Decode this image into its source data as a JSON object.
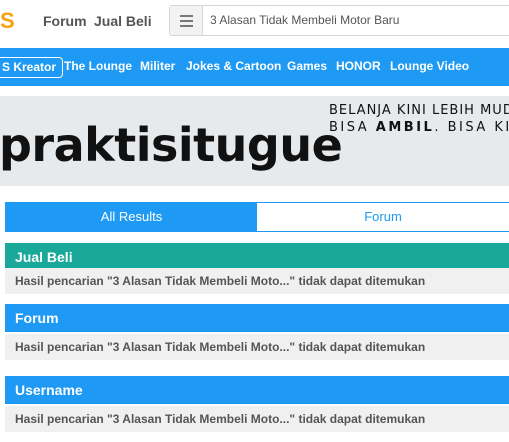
{
  "header": {
    "logo": "S",
    "nav": [
      "Forum",
      "Jual Beli"
    ],
    "search_value": "3 Alasan Tidak Membeli Motor Baru"
  },
  "channels": {
    "kreator": "S Kreator",
    "items": [
      "The Lounge",
      "Militer",
      "Jokes & Cartoon",
      "Games",
      "HONOR",
      "Lounge Video"
    ]
  },
  "banner": {
    "name": "praktisitugue",
    "line1": "BELANJA KINI LEBIH MUDAH",
    "line2_a": "BISA ",
    "line2_b": "AMBIL",
    "line2_c": ". BISA KI"
  },
  "tabs": {
    "all": "All Results",
    "forum": "Forum"
  },
  "results": [
    {
      "title": "Jual Beli",
      "message": "Hasil pencarian \"3 Alasan Tidak Membeli Moto...\" tidak dapat ditemukan"
    },
    {
      "title": "Forum",
      "message": "Hasil pencarian \"3 Alasan Tidak Membeli Moto...\" tidak dapat ditemukan"
    },
    {
      "title": "Username",
      "message": "Hasil pencarian \"3 Alasan Tidak Membeli Moto...\" tidak dapat ditemukan"
    }
  ],
  "colors": {
    "brand_orange": "#f8a10f",
    "nav_blue": "#1e9af5",
    "jualbeli_teal": "#1aa89a",
    "section_blue": "#1e9af5"
  }
}
